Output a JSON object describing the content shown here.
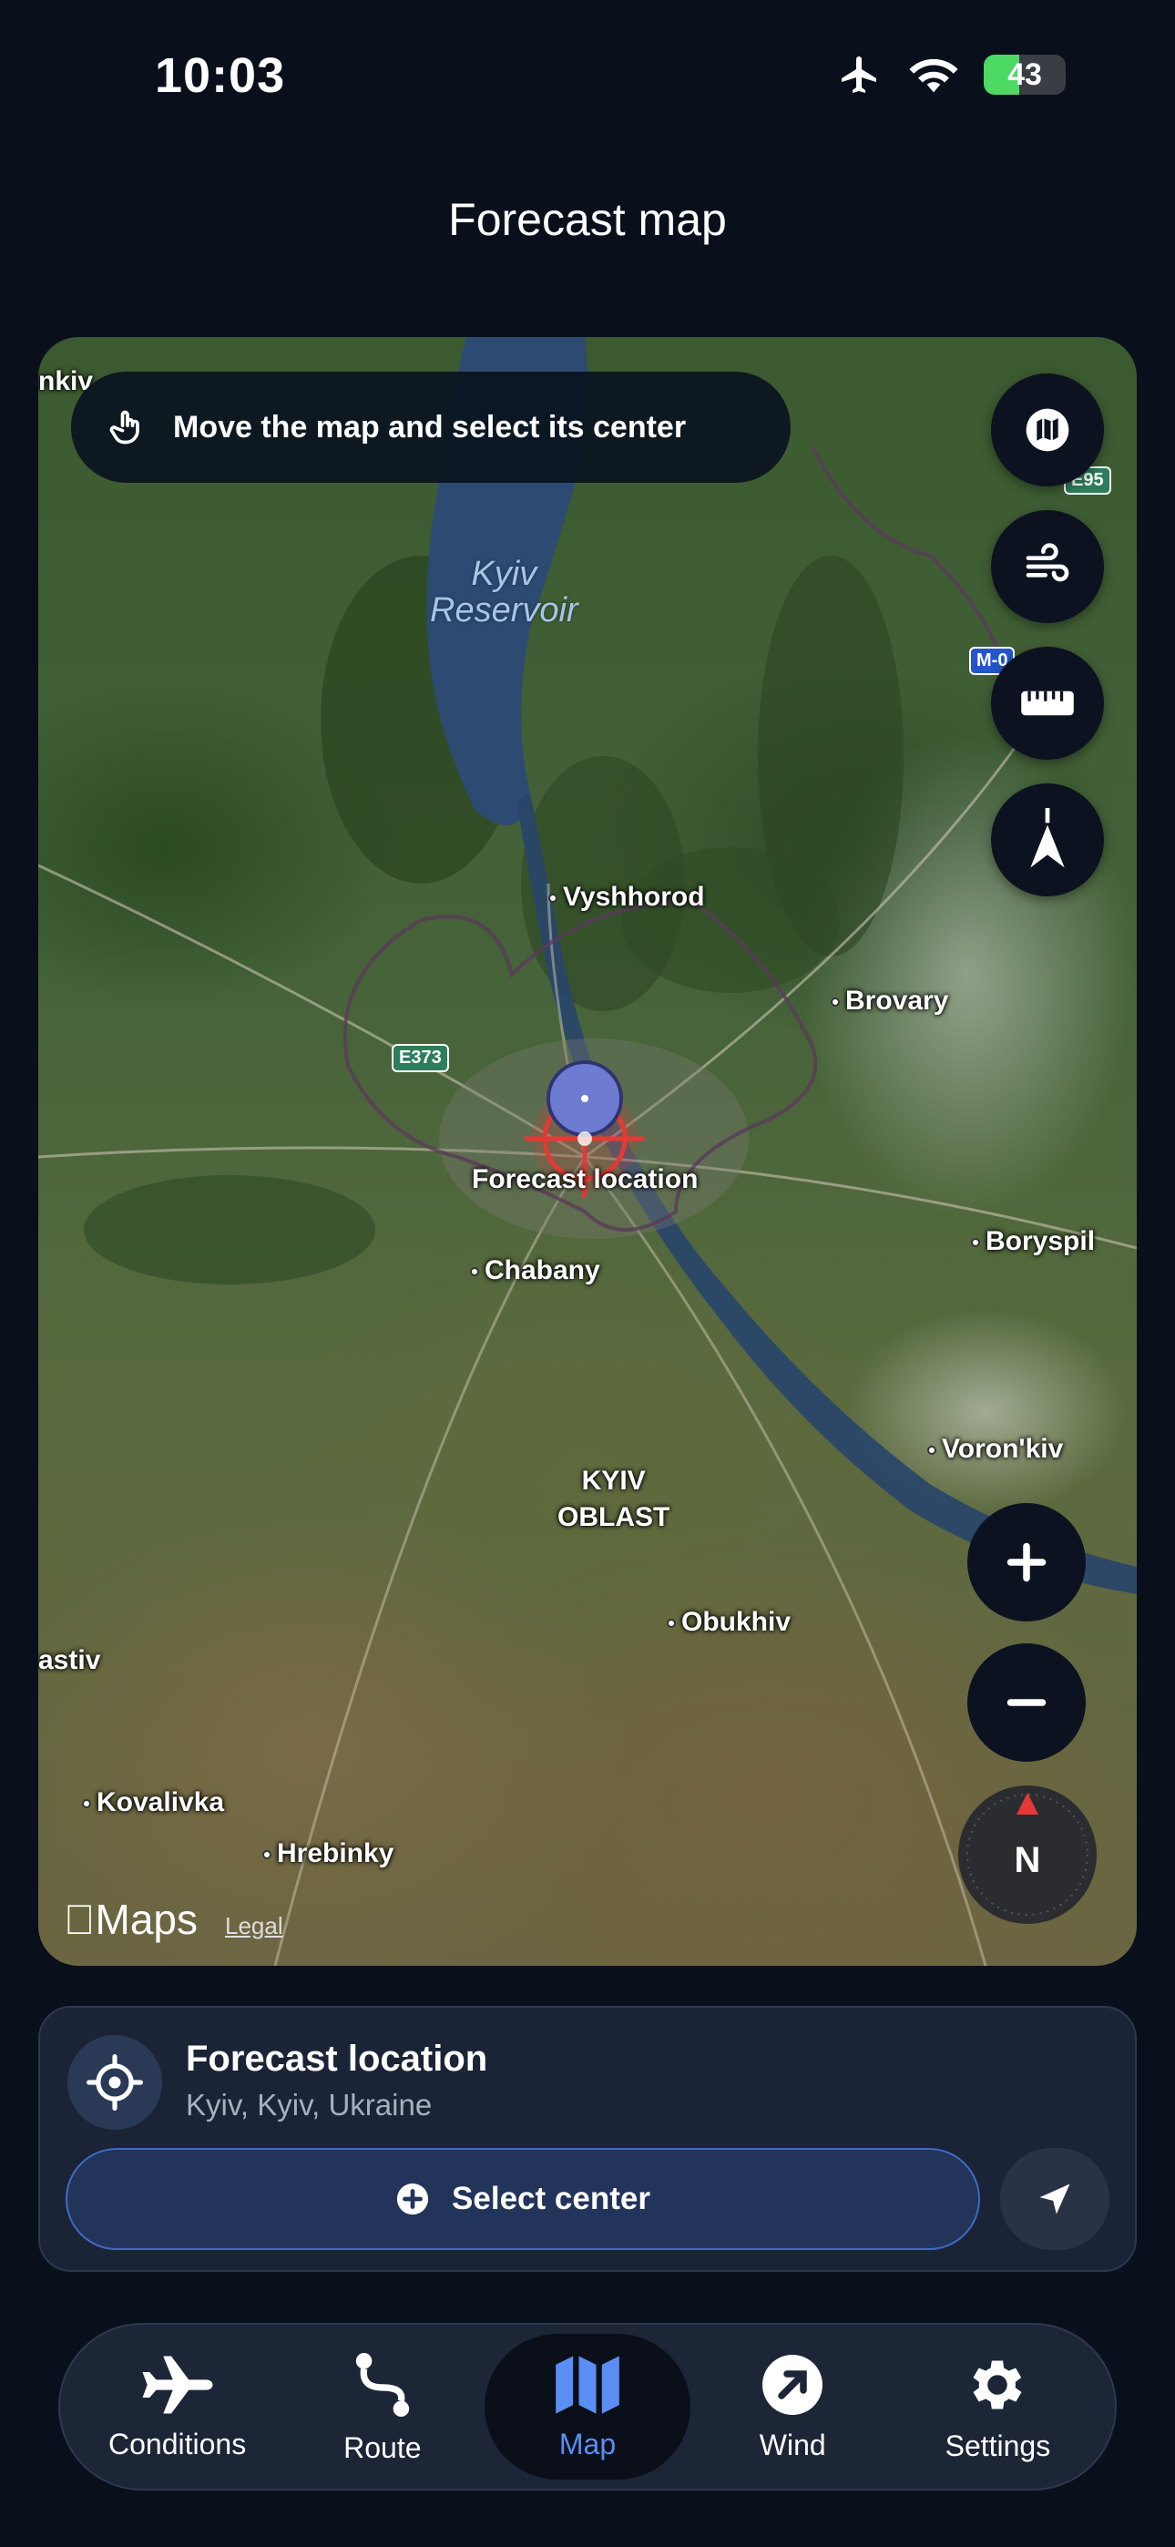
{
  "status_bar": {
    "time": "10:03",
    "battery": "43"
  },
  "header": {
    "title": "Forecast map"
  },
  "map": {
    "hint": "Move the map and select its center",
    "water_label_line1": "Kyiv",
    "water_label_line2": "Reservoir",
    "places": {
      "vyshhorod": "Vyshhorod",
      "brovary": "Brovary",
      "boryspil": "Boryspil",
      "chabany": "Chabany",
      "voronkiv": "Voron'kiv",
      "obukhiv": "Obukhiv",
      "kovalivka": "Kovalivka",
      "hrebinky": "Hrebinky",
      "nkiv": "nkiv",
      "astiv": "astiv",
      "region_line1": "KYIV",
      "region_line2": "OBLAST"
    },
    "roads": {
      "e373": "E373",
      "e95": "E95",
      "m0": "M-0"
    },
    "marker_label": "Forecast location",
    "brand": "Maps",
    "legal": "Legal",
    "compass": "N",
    "controls": [
      "map-layers",
      "wind-overlay",
      "ruler",
      "north-up"
    ]
  },
  "location_card": {
    "title": "Forecast location",
    "subtitle": "Kyiv, Kyiv, Ukraine",
    "select_label": "Select center"
  },
  "tabs": [
    {
      "label": "Conditions",
      "icon": "airplane-icon"
    },
    {
      "label": "Route",
      "icon": "route-icon"
    },
    {
      "label": "Map",
      "icon": "map-icon",
      "active": true
    },
    {
      "label": "Wind",
      "icon": "wind-arrow-icon"
    },
    {
      "label": "Settings",
      "icon": "gear-icon"
    }
  ],
  "colors": {
    "accent": "#5b8ef2",
    "marker": "#e53935",
    "background": "#0a0f1c"
  }
}
